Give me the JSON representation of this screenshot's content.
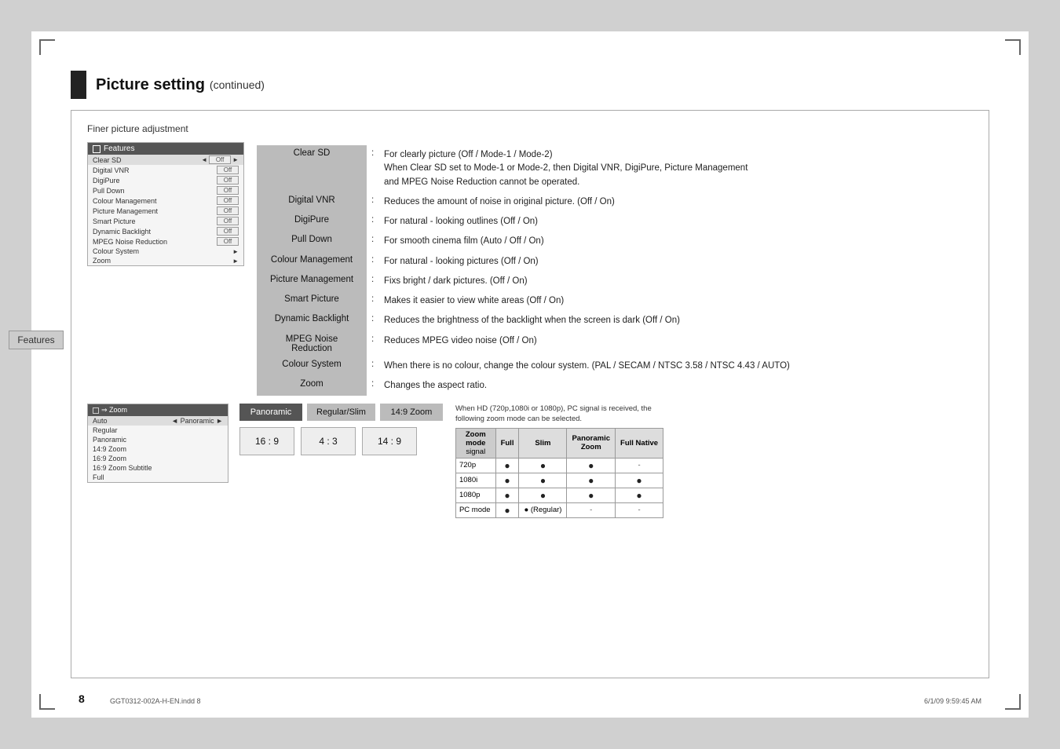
{
  "page": {
    "background": "#d0d0d0",
    "number": "8",
    "footer_file": "GGT0312-002A-H-EN.indd  8",
    "footer_date": "6/1/09  9:59:45 AM"
  },
  "header": {
    "title": "Picture setting",
    "subtitle": "(continued)"
  },
  "finer_title": "Finer picture adjustment",
  "menu": {
    "title": "Features",
    "items": [
      {
        "label": "Clear SD",
        "value": "Off",
        "selected": true,
        "arrows": true
      },
      {
        "label": "Digital VNR",
        "value": "Off",
        "selected": false
      },
      {
        "label": "DigiPure",
        "value": "Off",
        "selected": false
      },
      {
        "label": "Pull Down",
        "value": "Off",
        "selected": false
      },
      {
        "label": "Colour Management",
        "value": "Off",
        "selected": false
      },
      {
        "label": "Picture Management",
        "value": "Off",
        "selected": false
      },
      {
        "label": "Smart Picture",
        "value": "Off",
        "selected": false
      },
      {
        "label": "Dynamic Backlight",
        "value": "Off",
        "selected": false
      },
      {
        "label": "MPEG Noise Reduction",
        "value": "Off",
        "selected": false
      },
      {
        "label": "Colour System",
        "value": "",
        "arrow": true
      },
      {
        "label": "Zoom",
        "value": "",
        "arrow": true
      }
    ]
  },
  "features": [
    {
      "name": "Clear SD",
      "colon": ":",
      "desc_line1": "For clearly picture (Off / Mode-1 / Mode-2)",
      "desc_line2": "When Clear SD set to Mode-1 or Mode-2, then Digital VNR, DigiPure, Picture Management",
      "desc_line3": "and MPEG Noise Reduction cannot be operated."
    },
    {
      "name": "Digital VNR",
      "colon": ":",
      "desc": "Reduces the amount of noise in original picture. (Off / On)"
    },
    {
      "name": "DigiPure",
      "colon": ":",
      "desc": "For natural - looking outlines (Off / On)"
    },
    {
      "name": "Pull Down",
      "colon": ":",
      "desc": "For smooth cinema film (Auto / Off / On)"
    },
    {
      "name": "Colour Management",
      "colon": ":",
      "desc": "For natural - looking pictures (Off / On)"
    },
    {
      "name": "Picture Management",
      "colon": ":",
      "desc": "Fixs bright / dark pictures. (Off / On)"
    },
    {
      "name": "Smart Picture",
      "colon": ":",
      "desc": "Makes it easier to view white areas (Off / On)"
    },
    {
      "name": "Dynamic Backlight",
      "colon": ":",
      "desc": "Reduces the brightness of the backlight when the screen is dark (Off / On)"
    },
    {
      "name": "MPEG Noise\nReduction",
      "colon": ":",
      "desc": "Reduces MPEG video noise (Off / On)"
    },
    {
      "name": "Colour System",
      "colon": ":",
      "desc": "When there is no colour, change the colour system. (PAL / SECAM / NTSC 3.58 / NTSC 4.43 / AUTO)"
    },
    {
      "name": "Zoom",
      "colon": ":",
      "desc": "Changes the aspect ratio."
    }
  ],
  "features_label": "Features",
  "zoom_menu": {
    "title": "Zoom",
    "items": [
      {
        "label": "Auto",
        "value": "Panoramic",
        "selected": true,
        "arrows": true
      },
      {
        "label": "Regular"
      },
      {
        "label": "Panoramic"
      },
      {
        "label": "14:9 Zoom"
      },
      {
        "label": "16:9 Zoom"
      },
      {
        "label": "16:9 Zoom Subtitle"
      },
      {
        "label": "Full"
      }
    ]
  },
  "zoom_buttons": [
    {
      "label": "Panoramic",
      "active": true
    },
    {
      "label": "Regular/Slim",
      "active": false
    },
    {
      "label": "14:9 Zoom",
      "active": false
    }
  ],
  "ratio_buttons": [
    {
      "label": "16 : 9"
    },
    {
      "label": "4 : 3"
    },
    {
      "label": "14 : 9"
    }
  ],
  "zoom_info": "When HD (720p,1080i or 1080p), PC signal is received, the following zoom mode can be selected.",
  "zoom_table": {
    "headers": [
      "Zoom\nmode",
      "Full",
      "Slim",
      "Panoramic\nZoom",
      "Full Native"
    ],
    "rows": [
      {
        "signal": "720p",
        "full": "●",
        "slim": "●",
        "panoramic_zoom": "●",
        "full_native": "-"
      },
      {
        "signal": "1080i",
        "full": "●",
        "slim": "●",
        "panoramic_zoom": "●",
        "full_native": "●"
      },
      {
        "signal": "1080p",
        "full": "●",
        "slim": "●",
        "panoramic_zoom": "●",
        "full_native": "●"
      },
      {
        "signal": "PC mode",
        "full": "●",
        "slim": "● (Regular)",
        "panoramic_zoom": "-",
        "full_native": "-"
      }
    ]
  }
}
